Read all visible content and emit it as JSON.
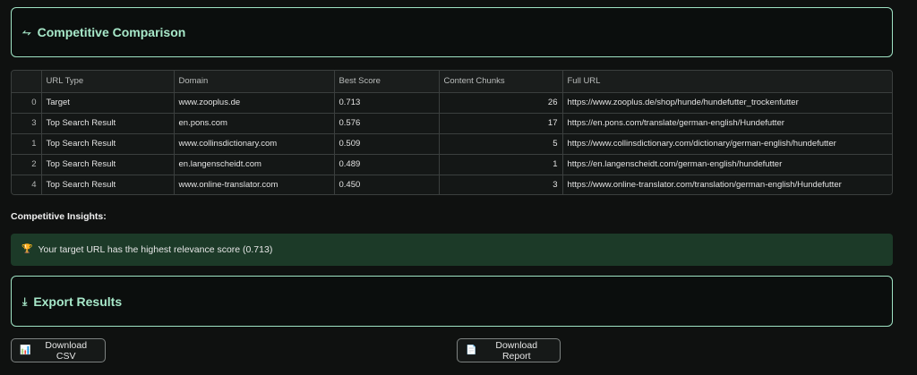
{
  "comparison": {
    "title": "Competitive Comparison",
    "icon": "arrows-compare-icon"
  },
  "table": {
    "columns": [
      "",
      "URL Type",
      "Domain",
      "Best Score",
      "Content Chunks",
      "Full URL"
    ],
    "rows": [
      [
        "0",
        "Target",
        "www.zooplus.de",
        "0.713",
        "26",
        "https://www.zooplus.de/shop/hunde/hundefutter_trockenfutter"
      ],
      [
        "3",
        "Top Search Result",
        "en.pons.com",
        "0.576",
        "17",
        "https://en.pons.com/translate/german-english/Hundefutter"
      ],
      [
        "1",
        "Top Search Result",
        "www.collinsdictionary.com",
        "0.509",
        "5",
        "https://www.collinsdictionary.com/dictionary/german-english/hundefutter"
      ],
      [
        "2",
        "Top Search Result",
        "en.langenscheidt.com",
        "0.489",
        "1",
        "https://en.langenscheidt.com/german-english/hundefutter"
      ],
      [
        "4",
        "Top Search Result",
        "www.online-translator.com",
        "0.450",
        "3",
        "https://www.online-translator.com/translation/german-english/Hundefutter"
      ]
    ]
  },
  "insights": {
    "title": "Competitive Insights:",
    "message": "Your target URL has the highest relevance score (0.713)",
    "icon": "trophy-icon"
  },
  "export": {
    "title": "Export Results",
    "icon": "download-icon"
  },
  "buttons": {
    "csv": {
      "label": "Download CSV",
      "icon": "chart-icon"
    },
    "report": {
      "label": "Download Report",
      "icon": "document-icon"
    }
  },
  "colors": {
    "accent": "#a7e8c9",
    "border": "#9fe3c4",
    "success_bg": "#1c3a28"
  }
}
